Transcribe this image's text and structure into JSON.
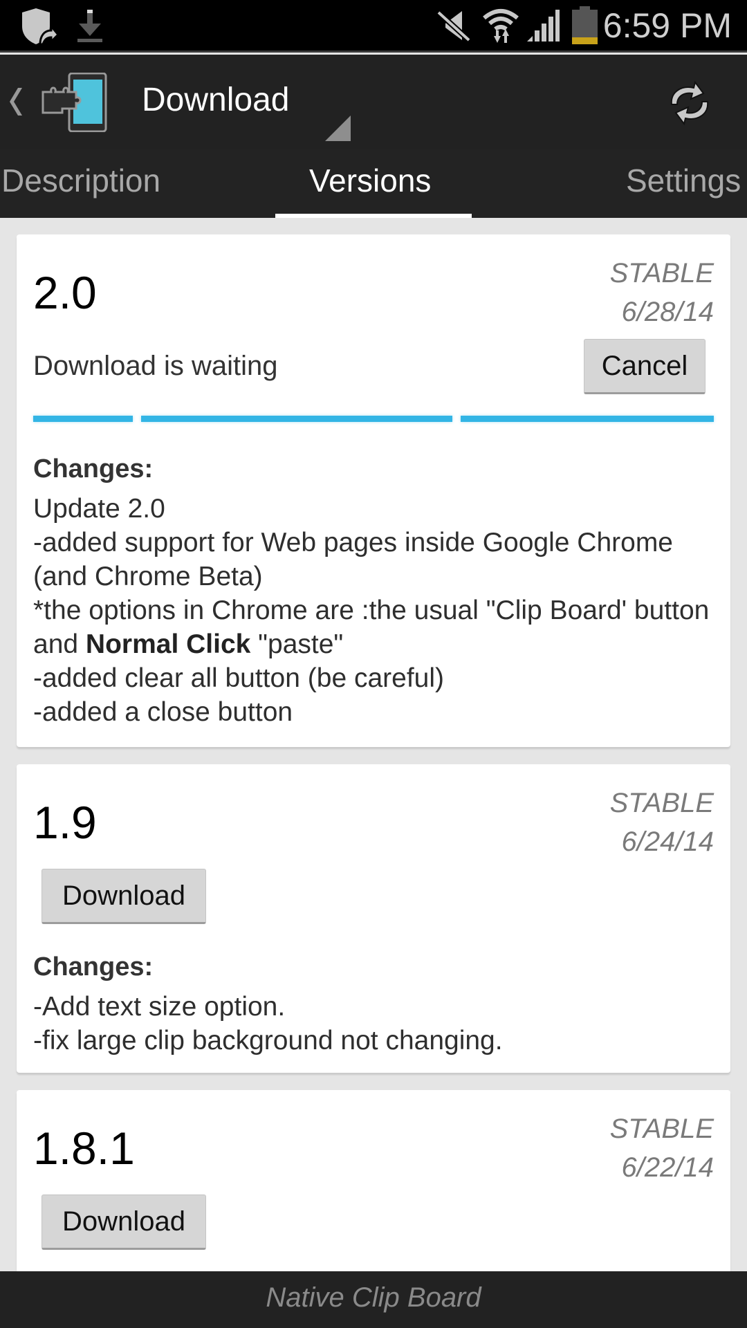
{
  "status_bar": {
    "time": "6:59 PM",
    "icons": [
      "shield-sync-icon",
      "download-icon",
      "mute-icon",
      "wifi-icon",
      "signal-icon",
      "battery-icon"
    ],
    "battery_level_pct": 20,
    "battery_color": "#c8a21a"
  },
  "app_bar": {
    "title": "Download",
    "icons": [
      "back-chevron-icon",
      "app-puzzle-phone-icon",
      "refresh-icon"
    ],
    "icon_accent": "#4fc3dc"
  },
  "tabs": [
    {
      "label": "Description",
      "active": false
    },
    {
      "label": "Versions",
      "active": true
    },
    {
      "label": "Settings",
      "active": false
    }
  ],
  "versions": [
    {
      "version": "2.0",
      "channel": "STABLE",
      "date": "6/28/14",
      "status": "Download is waiting",
      "action_label": "Cancel",
      "progress_state": "indeterminate",
      "progress_color": "#33b5e5",
      "changes_title": "Changes:",
      "changes": [
        "Update 2.0",
        "-added support for Web pages inside Google Chrome (and Chrome Beta)",
        "*the options in Chrome are :the usual \"Clip Board' button and ",
        "Normal Click",
        " \"paste\"",
        "-added clear all button (be careful)",
        "-added a close button"
      ]
    },
    {
      "version": "1.9",
      "channel": "STABLE",
      "date": "6/24/14",
      "action_label": "Download",
      "changes_title": "Changes:",
      "changes": [
        "-Add text size option.",
        "-fix large clip background not changing."
      ]
    },
    {
      "version": "1.8.1",
      "channel": "STABLE",
      "date": "6/22/14",
      "action_label": "Download"
    }
  ],
  "footer": {
    "text": "Native Clip Board"
  }
}
